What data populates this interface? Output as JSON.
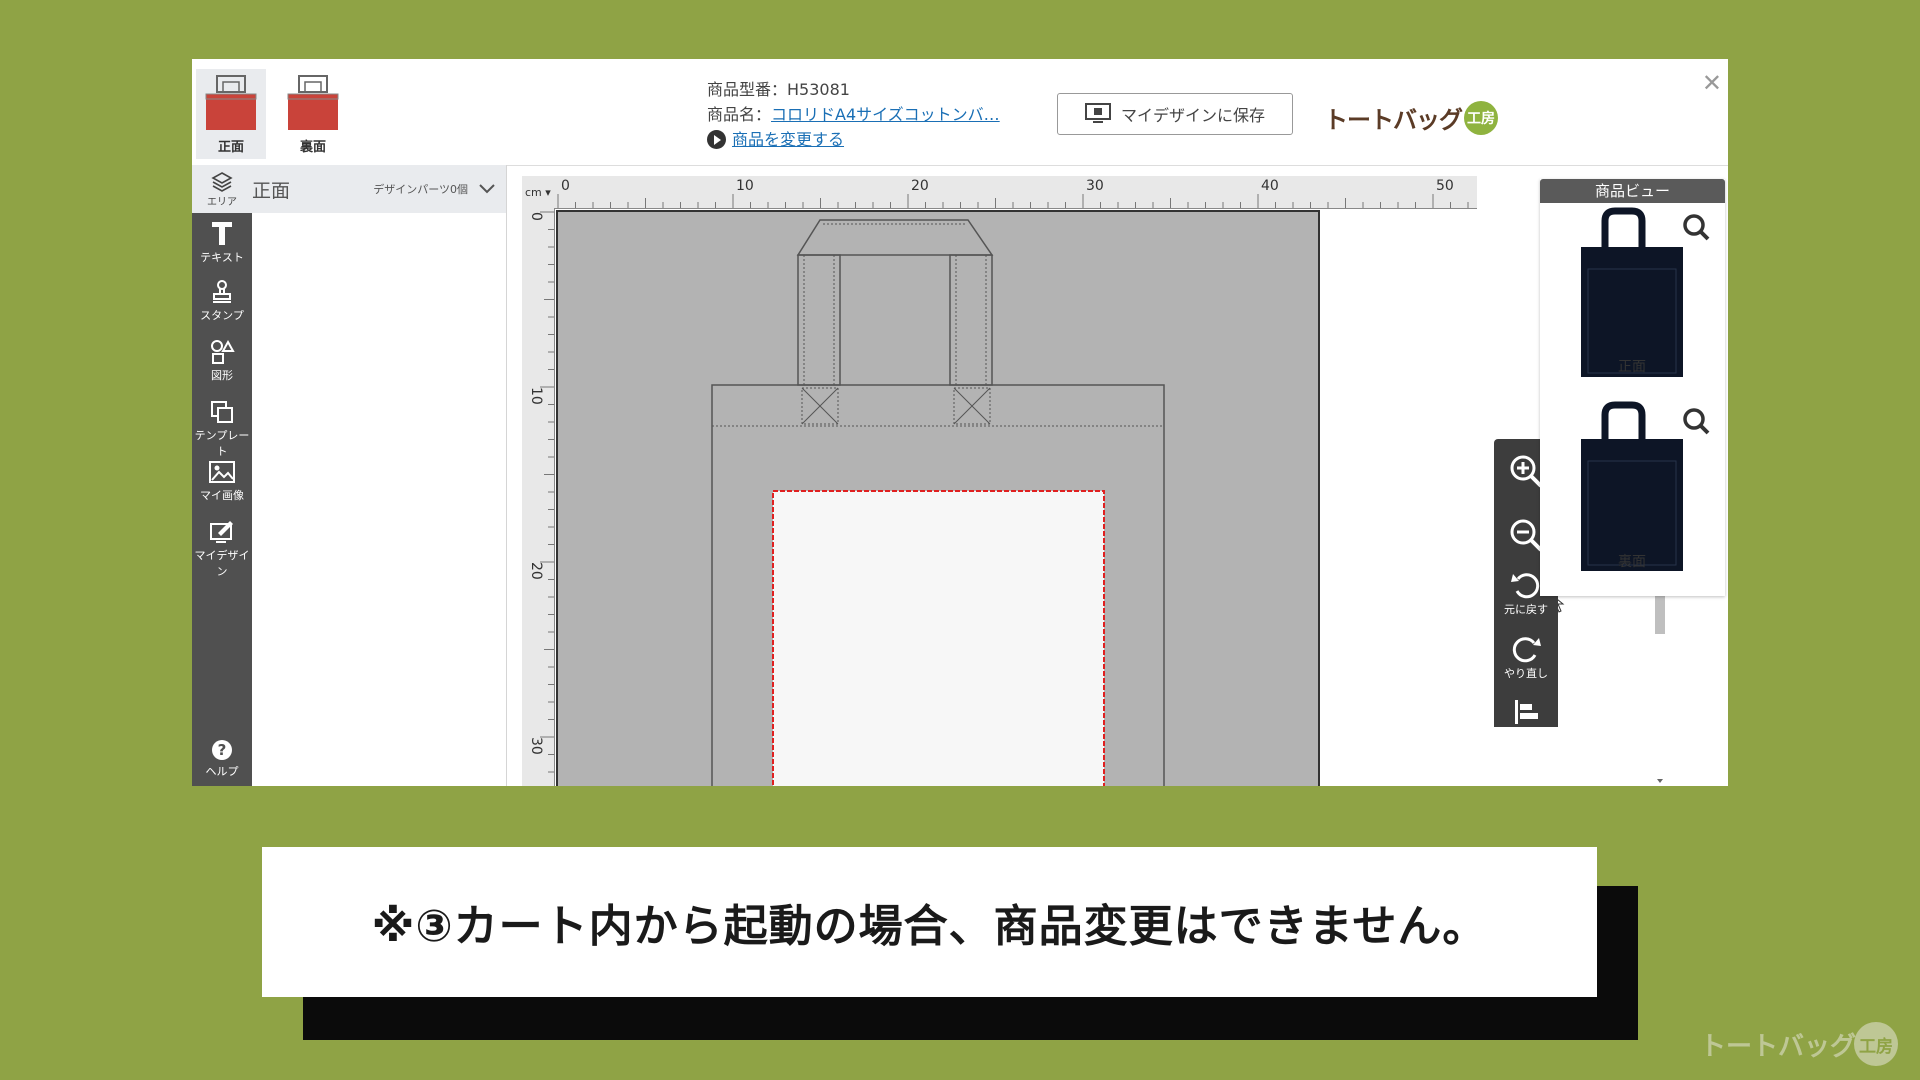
{
  "header": {
    "sides": [
      {
        "label": "正面",
        "active": true
      },
      {
        "label": "裏面",
        "active": false
      }
    ],
    "product_code": "商品型番：H53081",
    "product_name_label": "商品名：",
    "product_name": "コロリドA4サイズコットンバ…",
    "change_product": "商品を変更する",
    "save_button": "マイデザインに保存",
    "logo_text": "トートバッグ",
    "logo_badge": "工房"
  },
  "toolbar": {
    "area": "エリア",
    "items": [
      "テキスト",
      "スタンプ",
      "図形",
      "テンプレート",
      "マイ画像",
      "マイデザイン"
    ],
    "help": "ヘルプ"
  },
  "layers": {
    "title": "正面",
    "count": "デザインパーツ0個"
  },
  "ruler": {
    "unit": "cm",
    "h_labels": [
      "0",
      "10",
      "20",
      "30",
      "40",
      "50"
    ],
    "v_labels": [
      "0",
      "10",
      "20",
      "30"
    ]
  },
  "actions": {
    "undo": "元に戻す",
    "redo": "やり直し",
    "align": "配置"
  },
  "product_view": {
    "title": "商品ビュー",
    "items": [
      {
        "label": "正面"
      },
      {
        "label": "裏面"
      }
    ],
    "bag_color": "#0d1526"
  },
  "caption": "※③カート内から起動の場合、商品変更はできません。",
  "watermark": {
    "text": "トートバッグ",
    "badge": "工房"
  },
  "colors": {
    "background": "#8fa345",
    "bag_thumb": "#c9433a",
    "print_area_border": "#e02020"
  }
}
